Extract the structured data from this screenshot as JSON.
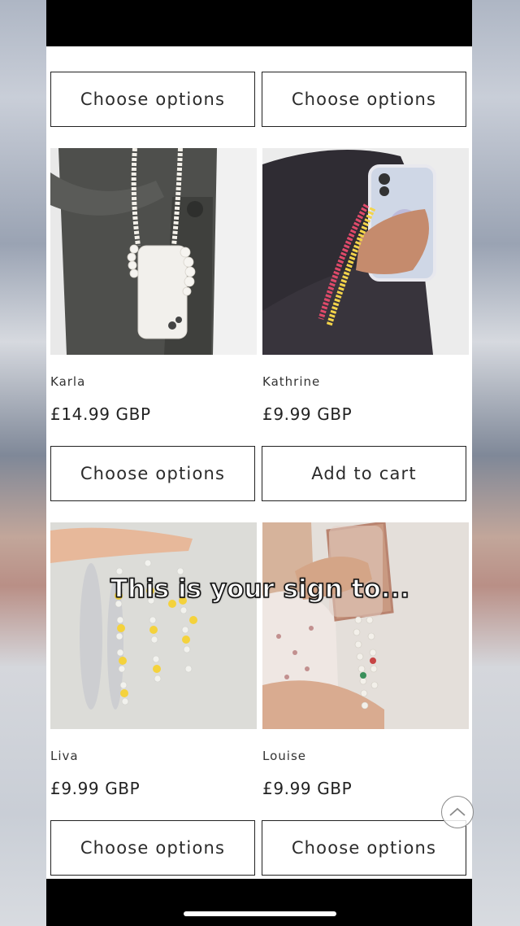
{
  "caption": "This is your sign to...",
  "products": [
    {
      "name": "",
      "price": "",
      "button": "Choose options"
    },
    {
      "name": "",
      "price": "",
      "button": "Choose options"
    },
    {
      "name": "Karla",
      "price": "£14.99 GBP",
      "button": "Choose options"
    },
    {
      "name": "Kathrine",
      "price": "£9.99 GBP",
      "button": "Add to cart"
    },
    {
      "name": "Liva",
      "price": "£9.99 GBP",
      "button": "Choose options"
    },
    {
      "name": "Louise",
      "price": "£9.99 GBP",
      "button": "Choose options"
    }
  ],
  "icons": {
    "scroll_top": "chevron-up-icon"
  },
  "colors": {
    "page_bg": "#ffffff",
    "button_border": "#222222",
    "text": "#2b2b2b"
  }
}
